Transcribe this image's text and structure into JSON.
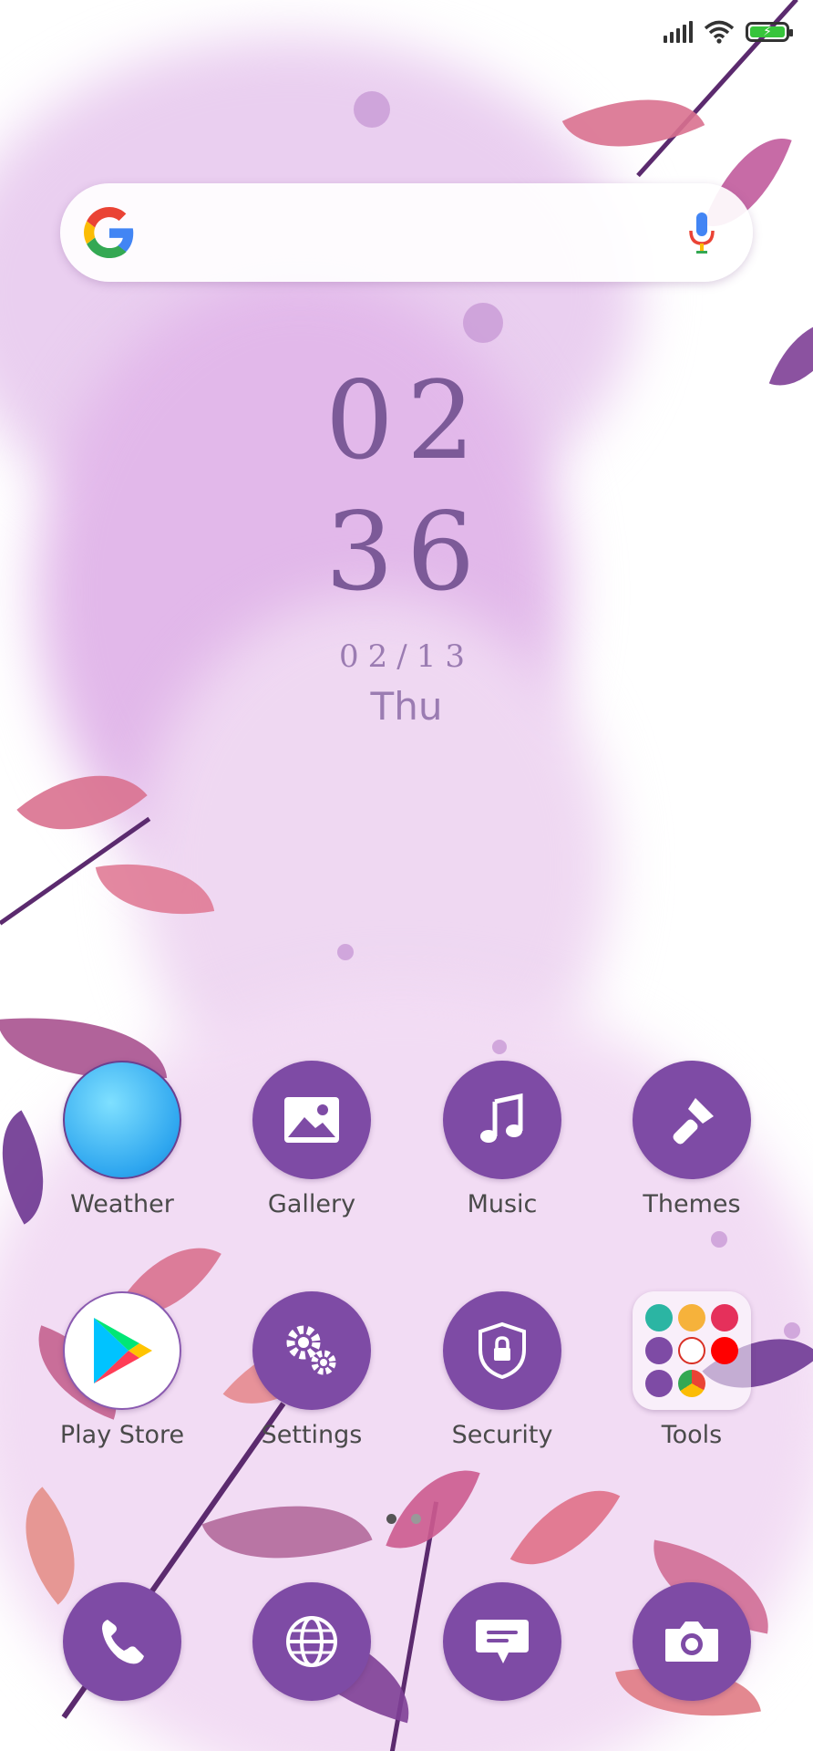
{
  "status_bar": {
    "signal_icon": "signal-icon",
    "wifi_icon": "wifi-icon",
    "battery_icon": "battery-charging-icon",
    "battery_level": 0.9
  },
  "search_bar": {
    "logo": "google-logo-icon",
    "mic": "mic-icon"
  },
  "clock": {
    "hour": "02",
    "minute": "36",
    "date": "02/13",
    "day": "Thu"
  },
  "apps_row1": [
    {
      "label": "Weather",
      "icon": "weather-icon"
    },
    {
      "label": "Gallery",
      "icon": "gallery-icon"
    },
    {
      "label": "Music",
      "icon": "music-icon"
    },
    {
      "label": "Themes",
      "icon": "themes-icon"
    }
  ],
  "apps_row2": [
    {
      "label": "Play Store",
      "icon": "play-store-icon"
    },
    {
      "label": "Settings",
      "icon": "settings-icon"
    },
    {
      "label": "Security",
      "icon": "security-icon"
    },
    {
      "label": "Tools",
      "icon": "tools-folder-icon"
    }
  ],
  "dock": [
    {
      "icon": "phone-icon"
    },
    {
      "icon": "browser-icon"
    },
    {
      "icon": "messages-icon"
    },
    {
      "icon": "camera-icon"
    }
  ],
  "colors": {
    "accent": "#7e4ba5",
    "clock": "#7c5a98",
    "leaf_pink": "#d9718f",
    "leaf_purple": "#7e3f96"
  },
  "page_indicator": {
    "count": 2,
    "active": 1
  }
}
